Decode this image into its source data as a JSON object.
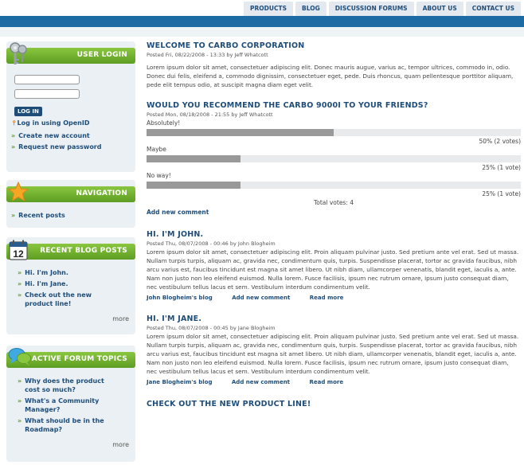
{
  "nav": {
    "tabs": [
      "PRODUCTS",
      "BLOG",
      "DISCUSSION FORUMS",
      "ABOUT US",
      "CONTACT US"
    ]
  },
  "sidebar": {
    "login": {
      "title": "USER LOGIN",
      "button": "LOG IN",
      "openid": "Log in using OpenID",
      "links": [
        "Create new account",
        "Request new password"
      ]
    },
    "navigation": {
      "title": "NAVIGATION",
      "links": [
        "Recent posts"
      ]
    },
    "recent_blog": {
      "title": "RECENT BLOG POSTS",
      "calendar_day": "12",
      "links": [
        "Hi. I'm John.",
        "Hi. I'm Jane.",
        "Check out the new product line!"
      ],
      "more": "more"
    },
    "forum": {
      "title": "ACTIVE FORUM TOPICS",
      "links": [
        "Why does the product cost so much?",
        "What's a Community Manager?",
        "What should be in the Roadmap?"
      ],
      "more": "more"
    }
  },
  "posts": [
    {
      "title": "WELCOME TO CARBO CORPORATION",
      "meta": "Posted Fri, 08/22/2008 - 13:33 by Jeff Whatcott",
      "body": "Lorem ipsum dolor sit amet, consectetuer adipiscing elit. Donec mauris augue, varius ac, tempor ultrices, commodo in, odio. Donec dui felis, eleifend a, commodo dignissim, consectetuer eget, pede. Duis rhoncus, quam pellentesque porttitor aliquam, pede elit tempus odio, at suscipit magna diam eget velit."
    },
    {
      "title": "HI. I'M JOHN.",
      "meta": "Posted Thu, 08/07/2008 - 00:46 by John Blogheim",
      "body": "Lorem ipsum dolor sit amet, consectetuer adipiscing elit. Proin aliquam pulvinar justo. Sed pretium ante vel erat. Sed ut massa. Nullam turpis turpis, aliquam ac, gravida nec, condimentum quis, turpis. Suspendisse placerat, tortor ac gravida faucibus, nibh arcu varius est, faucibus tincidunt est magna sit amet libero. Ut nibh diam, ullamcorper venenatis, blandit eget, iaculis a, ante. Nam non justo non leo eleifend euismod. Nulla lorem. Fusce facilisis, ipsum nec rutrum ornare, ipsum justo consequat diam, nec vestibulum tellus lacus et sem. Vestibulum interdum condimentum velit.",
      "links": [
        "John Blogheim's blog",
        "Add new comment",
        "Read more"
      ]
    },
    {
      "title": "HI. I'M JANE.",
      "meta": "Posted Thu, 08/07/2008 - 00:45 by Jane Blogheim",
      "body": "Lorem ipsum dolor sit amet, consectetuer adipiscing elit. Proin aliquam pulvinar justo. Sed pretium ante vel erat. Sed ut massa. Nullam turpis turpis, aliquam ac, gravida nec, condimentum quis, turpis. Suspendisse placerat, tortor ac gravida faucibus, nibh arcu varius est, faucibus tincidunt est magna sit amet libero. Ut nibh diam, ullamcorper venenatis, blandit eget, iaculis a, ante. Nam non justo non leo eleifend euismod. Nulla lorem. Fusce facilisis, ipsum nec rutrum ornare, ipsum justo consequat diam, nec vestibulum tellus lacus et sem. Vestibulum interdum condimentum velit.",
      "links": [
        "Jane Blogheim's blog",
        "Add new comment",
        "Read more"
      ]
    },
    {
      "title": "CHECK OUT THE NEW PRODUCT LINE!"
    }
  ],
  "poll": {
    "title": "WOULD YOU RECOMMEND THE CARBO 9000I TO YOUR FRIENDS?",
    "meta": "Posted Mon, 08/18/2008 - 21:55 by Jeff Whatcott",
    "options": [
      {
        "label": "Absolutely!",
        "result": "50% (2 votes)",
        "fraction": 0.5
      },
      {
        "label": "Maybe",
        "result": "25% (1 vote)",
        "fraction": 0.25
      },
      {
        "label": "No way!",
        "result": "25% (1 vote)",
        "fraction": 0.25
      }
    ],
    "total": "Total votes: 4",
    "add_comment": "Add new comment"
  },
  "colors": {
    "brand_blue": "#1d6ba5",
    "link_blue": "#1f4d7a",
    "green": "#6aad2b"
  }
}
